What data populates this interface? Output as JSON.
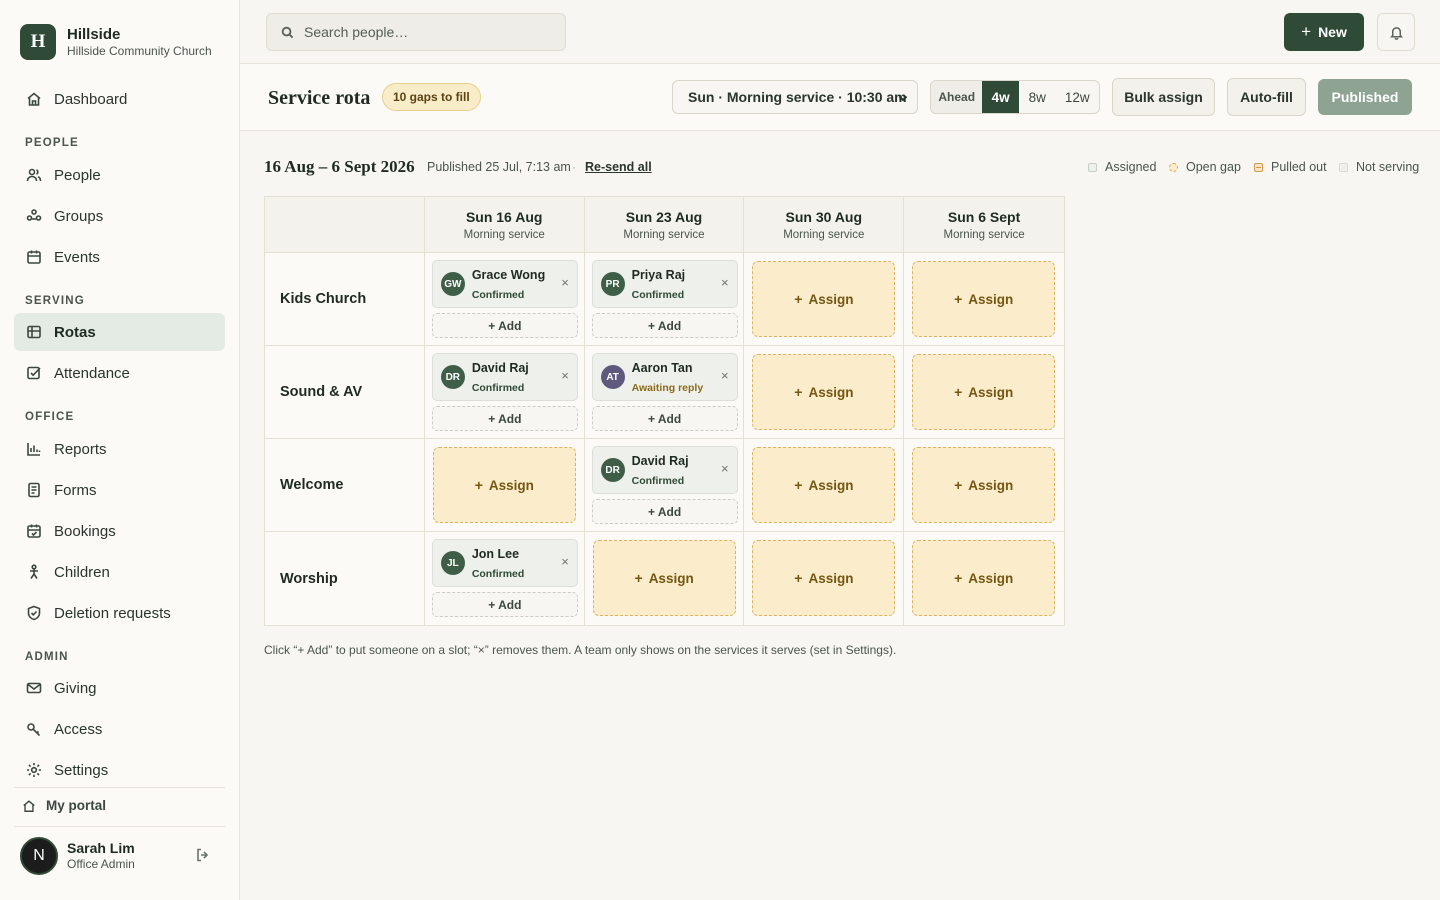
{
  "brand": {
    "initial": "H",
    "name": "Hillside",
    "subtitle": "Hillside Community Church"
  },
  "nav": {
    "dashboard": "Dashboard",
    "section_people": "PEOPLE",
    "people": "People",
    "groups": "Groups",
    "events": "Events",
    "section_serving": "SERVING",
    "rotas": "Rotas",
    "attendance": "Attendance",
    "section_office": "OFFICE",
    "reports": "Reports",
    "forms": "Forms",
    "bookings": "Bookings",
    "children": "Children",
    "deletion": "Deletion requests",
    "section_admin": "ADMIN",
    "giving": "Giving",
    "access": "Access",
    "settings": "Settings",
    "portal": "My portal"
  },
  "user": {
    "initial": "N",
    "name": "Sarah Lim",
    "role": "Office Admin"
  },
  "topbar": {
    "search_placeholder": "Search people…",
    "new_label": "New"
  },
  "header": {
    "title": "Service rota",
    "gaps_badge": "10 gaps to fill",
    "service_select": "Sun · Morning service · 10:30 am",
    "ahead_label": "Ahead",
    "ahead_options": [
      "4w",
      "8w",
      "12w"
    ],
    "ahead_selected": "4w",
    "bulk_assign": "Bulk assign",
    "auto_fill": "Auto-fill",
    "published": "Published"
  },
  "range": {
    "title": "16 Aug – 6 Sept 2026",
    "published_meta": "Published 25 Jul, 7:13 am",
    "separator": "·",
    "resend": "Re-send all"
  },
  "legend": {
    "assigned": "Assigned",
    "open": "Open gap",
    "pulled": "Pulled out",
    "not_serving": "Not serving"
  },
  "rota": {
    "dates": [
      {
        "date": "Sun 16 Aug",
        "service": "Morning service"
      },
      {
        "date": "Sun 23 Aug",
        "service": "Morning service"
      },
      {
        "date": "Sun 30 Aug",
        "service": "Morning service"
      },
      {
        "date": "Sun 6 Sept",
        "service": "Morning service"
      }
    ],
    "teams": [
      {
        "name": "Kids Church",
        "slots": [
          {
            "initials": "GW",
            "name": "Grace Wong",
            "status": "Confirmed"
          },
          {
            "initials": "PR",
            "name": "Priya Raj",
            "status": "Confirmed"
          },
          null,
          null
        ]
      },
      {
        "name": "Sound & AV",
        "slots": [
          {
            "initials": "DR",
            "name": "David Raj",
            "status": "Confirmed"
          },
          {
            "initials": "AT",
            "name": "Aaron Tan",
            "status": "Awaiting reply"
          },
          null,
          null
        ]
      },
      {
        "name": "Welcome",
        "slots": [
          null,
          {
            "initials": "DR",
            "name": "David Raj",
            "status": "Confirmed"
          },
          null,
          null
        ]
      },
      {
        "name": "Worship",
        "slots": [
          {
            "initials": "JL",
            "name": "Jon Lee",
            "status": "Confirmed"
          },
          null,
          null,
          null
        ]
      }
    ],
    "remove_glyph": "×",
    "add_label": "+ Add",
    "assign_plus": "+",
    "assign_label": "Assign"
  },
  "helper": "Click “+ Add” to put someone on a slot; “×” removes them. A team only shows on the services it serves (set in Settings).",
  "colors": {
    "brand": "#2f4a37",
    "gap": "#fbeccb",
    "published": "#8ea392"
  }
}
